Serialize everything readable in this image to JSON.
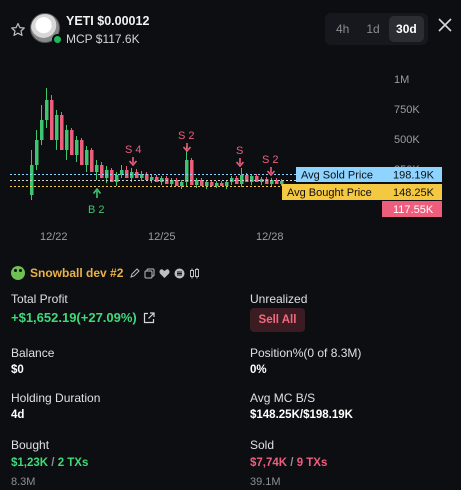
{
  "header": {
    "title": "YETI $0.00012",
    "mcp": "MCP $117.6K",
    "timeframes": [
      "4h",
      "1d",
      "30d"
    ],
    "active_timeframe": "30d"
  },
  "chart": {
    "y_ticks": [
      "1M",
      "750K",
      "500K",
      "250K"
    ],
    "x_ticks": [
      "12/22",
      "12/25",
      "12/28"
    ],
    "markers": {
      "s4": "S 4",
      "s2a": "S 2",
      "s": "S",
      "s2b": "S 2",
      "b2": "B 2"
    },
    "avg_sold": {
      "label": "Avg Sold Price",
      "value": "198.19K"
    },
    "avg_bought": {
      "label": "Avg Bought Price",
      "value": "148.25K"
    },
    "current": {
      "value": "117.55K"
    },
    "colors": {
      "up": "#3fc46f",
      "down": "#ef5d7d",
      "sold_line": "#8fd3ff",
      "bought_line": "#f5c842"
    }
  },
  "wallet": {
    "name": "Snowball dev #2"
  },
  "stats": {
    "total_profit_label": "Total Profit",
    "total_profit_value": "+$1,652.19(+27.09%)",
    "unrealized_label": "Unrealized",
    "sell_all": "Sell All",
    "balance_label": "Balance",
    "balance_value": "$0",
    "position_label": "Position%(0 of 8.3M)",
    "position_value": "0%",
    "holding_label": "Holding Duration",
    "holding_value": "4d",
    "avg_mc_label": "Avg MC B/S",
    "avg_mc_value": "$148.25K/$198.19K",
    "bought_label": "Bought",
    "bought_amount": "$1,23K",
    "bought_sep": " / ",
    "bought_txs": "2 TXs",
    "bought_qty": "8.3M",
    "sold_label": "Sold",
    "sold_amount": "$7,74K",
    "sold_sep": " / ",
    "sold_txs": "9 TXs",
    "sold_qty": "39.1M"
  }
}
